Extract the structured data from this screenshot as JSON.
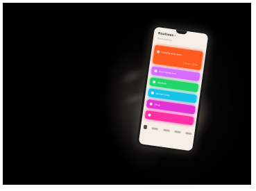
{
  "app": {
    "title": "Routines ›",
    "subtitle": "Good evening"
  },
  "cards": [
    {
      "label": "Evening wind-down",
      "extra": "5 steps · 30 min",
      "color": "#ff5a1f"
    },
    {
      "label": "Read before bed",
      "color": "#d66bff"
    },
    {
      "label": "Meditate",
      "color": "#22d66b"
    },
    {
      "label": "Journal today",
      "color": "#17c4e8"
    },
    {
      "label": "Sleep",
      "color": "#e234d6"
    },
    {
      "label": "",
      "color": "#ff2fa6"
    }
  ],
  "nav": [
    "home-icon",
    "today",
    "stats",
    "settings",
    "profile"
  ]
}
